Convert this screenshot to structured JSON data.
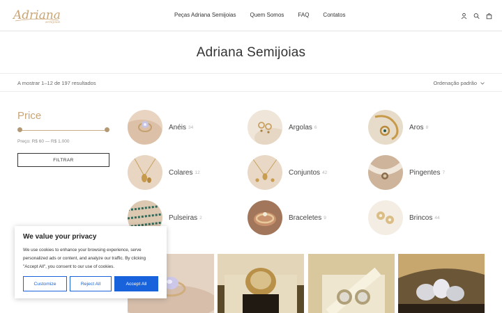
{
  "header": {
    "logo_text": "Adriana",
    "logo_subtext": "semijoias",
    "nav": [
      "Peças Adriana Semijoias",
      "Quem Somos",
      "FAQ",
      "Contatos"
    ],
    "icons": [
      "user-icon",
      "search-icon",
      "bag-icon"
    ]
  },
  "page": {
    "title": "Adriana Semijoias"
  },
  "results": {
    "count_text": "A mostrar 1–12 de 197 resultados",
    "ordering": "Ordenação padrão"
  },
  "filter": {
    "title": "Price",
    "price_text": "Preço: R$ 60 — R$ 1.000",
    "button": "FILTRAR"
  },
  "categories": [
    {
      "name": "Anéis",
      "count": "34"
    },
    {
      "name": "Argolas",
      "count": "6"
    },
    {
      "name": "Aros",
      "count": "8"
    },
    {
      "name": "Colares",
      "count": "12"
    },
    {
      "name": "Conjuntos",
      "count": "42"
    },
    {
      "name": "Pingentes",
      "count": "7"
    },
    {
      "name": "Pulseiras",
      "count": "2"
    },
    {
      "name": "Braceletes",
      "count": "9"
    },
    {
      "name": "Brincos",
      "count": "44"
    }
  ],
  "cookie": {
    "title": "We value your privacy",
    "text": "We use cookies to enhance your browsing experience, serve personalized ads or content, and analyze our traffic. By clicking \"Accept All\", you consent to our use of cookies.",
    "customize": "Customize",
    "reject": "Reject All",
    "accept": "Accept All"
  },
  "colors": {
    "accent_gold": "#c9a576",
    "cookie_blue": "#1863dc"
  }
}
